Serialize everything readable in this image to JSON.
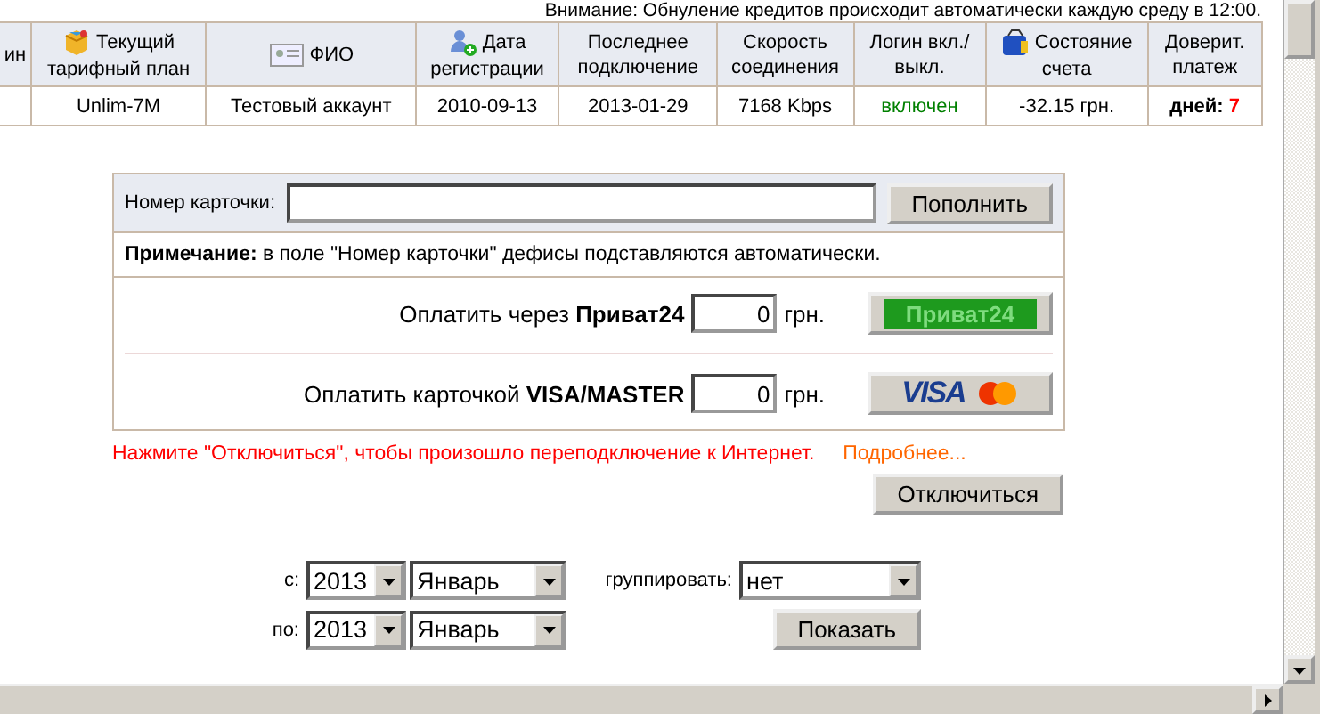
{
  "notice": "Внимание: Обнуление кредитов происходит автоматически каждую среду в 12:00.",
  "table": {
    "columns": [
      {
        "label": "ин"
      },
      {
        "label": "Текущий тарифный план"
      },
      {
        "label": "ФИО"
      },
      {
        "label": "Дата регистрации"
      },
      {
        "label": "Последнее подключение"
      },
      {
        "label": "Скорость соединения"
      },
      {
        "label": "Логин вкл./выкл."
      },
      {
        "label": "Состояние счета"
      },
      {
        "label": "Доверит. платеж"
      }
    ],
    "row": {
      "tariff": "Unlim-7M",
      "name": "Тестовый аккаунт",
      "registered": "2010-09-13",
      "last_connection": "2013-01-29",
      "speed": "7168 Kbps",
      "login_status": {
        "text": "включен",
        "color": "#008000"
      },
      "balance": "-32.15 грн.",
      "trust_payment": {
        "label": "дней:",
        "value": "7",
        "color": "#ff0000"
      }
    }
  },
  "card_form": {
    "label": "Номер карточки:",
    "button": "Пополнить",
    "note": "**Примечание:** в поле \"Номер карточки\" дефисы подставляются автоматически.",
    "payments": [
      {
        "kind": "privat",
        "label": "Оплатить через **Приват24**",
        "amount": "0",
        "currency": "грн.",
        "button_text": "Приват24"
      },
      {
        "kind": "visa",
        "label": "Оплатить карточкой **VISA/MASTER**",
        "amount": "0",
        "currency": "грн.",
        "button_text": "VISA"
      }
    ]
  },
  "reconnect": {
    "message": "Нажмите \"Отключиться\", чтобы произошло переподключение к Интернет.",
    "link": "Подробнее...",
    "button": "Отключиться"
  },
  "filter": {
    "from_label": "с:",
    "to_label": "по:",
    "from_year": "2013",
    "from_month": "Январь",
    "to_year": "2013",
    "to_month": "Январь",
    "group_label": "группировать:",
    "group_value": "нет",
    "button": "Показать"
  }
}
